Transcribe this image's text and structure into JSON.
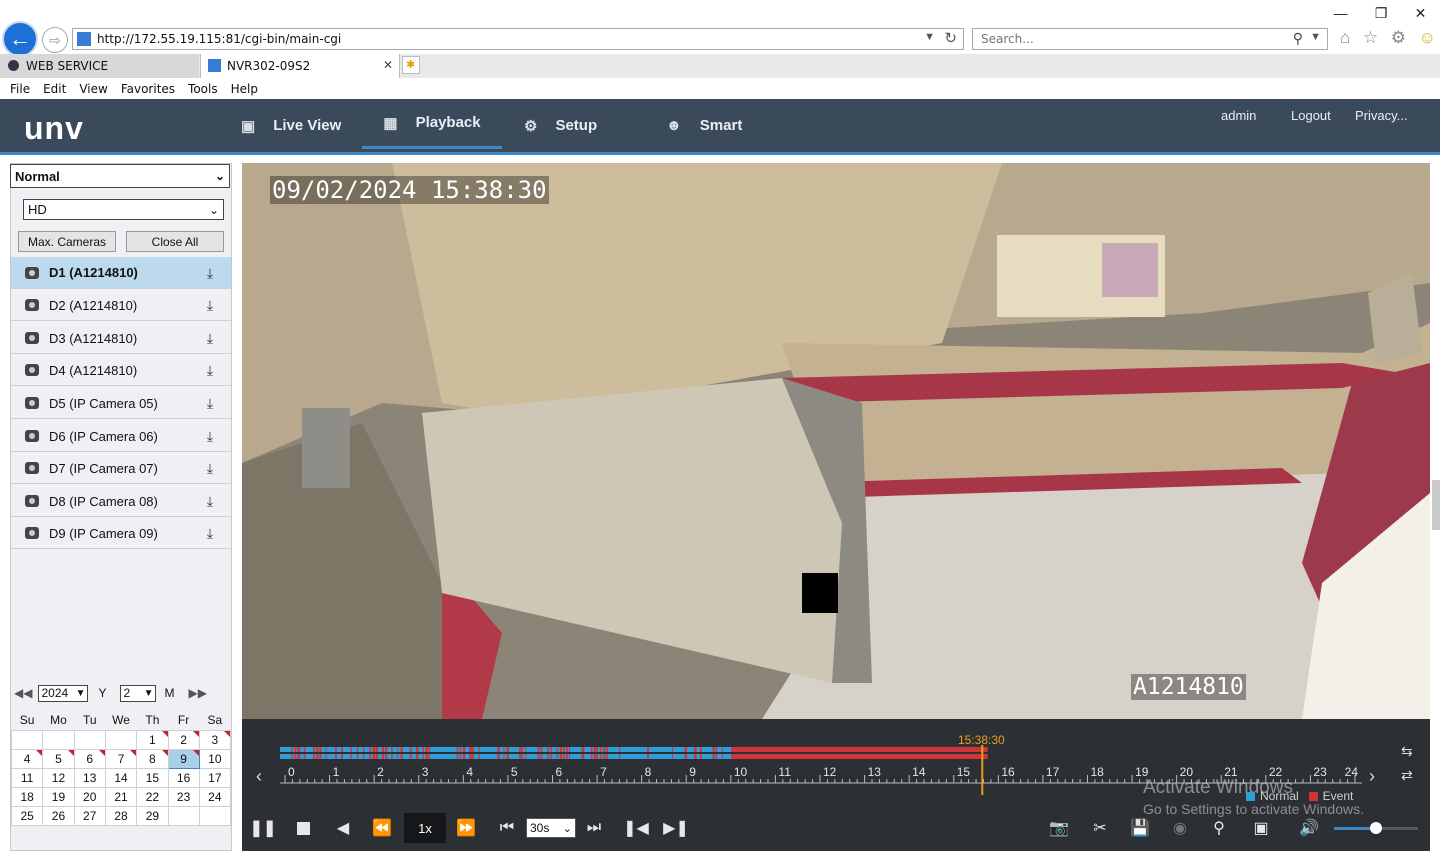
{
  "browser": {
    "url": "http://172.55.19.115:81/cgi-bin/main-cgi",
    "search_placeholder": "Search...",
    "tabs": [
      {
        "label": "WEB SERVICE"
      },
      {
        "label": "NVR302-09S2"
      }
    ],
    "menu": [
      "File",
      "Edit",
      "View",
      "Favorites",
      "Tools",
      "Help"
    ]
  },
  "app": {
    "logo": "unv",
    "nav": [
      {
        "label": "Live View",
        "icon": "monitor-icon"
      },
      {
        "label": "Playback",
        "icon": "film-icon",
        "active": true
      },
      {
        "label": "Setup",
        "icon": "gear-icon"
      },
      {
        "label": "Smart",
        "icon": "smart-user-icon"
      }
    ],
    "user": "admin",
    "logout": "Logout",
    "privacy": "Privacy..."
  },
  "sidebar": {
    "mode_select": "Normal",
    "stream_select": "HD",
    "max_cameras": "Max. Cameras",
    "close_all": "Close All",
    "cameras": [
      {
        "label": "D1 (A1214810)",
        "active": true
      },
      {
        "label": "D2 (A1214810)"
      },
      {
        "label": "D3 (A1214810)"
      },
      {
        "label": "D4 (A1214810)"
      },
      {
        "label": "D5 (IP Camera 05)"
      },
      {
        "label": "D6 (IP Camera 06)"
      },
      {
        "label": "D7 (IP Camera 07)"
      },
      {
        "label": "D8 (IP Camera 08)"
      },
      {
        "label": "D9 (IP Camera 09)"
      }
    ]
  },
  "calendar": {
    "year": "2024",
    "year_label": "Y",
    "month": "2",
    "month_label": "M",
    "weekdays": [
      "Su",
      "Mo",
      "Tu",
      "We",
      "Th",
      "Fr",
      "Sa"
    ],
    "weeks": [
      [
        "",
        "",
        "",
        "",
        "1",
        "2",
        "3"
      ],
      [
        "4",
        "5",
        "6",
        "7",
        "8",
        "9",
        "10"
      ],
      [
        "11",
        "12",
        "13",
        "14",
        "15",
        "16",
        "17"
      ],
      [
        "18",
        "19",
        "20",
        "21",
        "22",
        "23",
        "24"
      ],
      [
        "25",
        "26",
        "27",
        "28",
        "29",
        "",
        ""
      ]
    ],
    "marked_days": [
      "1",
      "2",
      "3",
      "4",
      "5",
      "6",
      "7",
      "8",
      "9"
    ],
    "selected_day": "9"
  },
  "video": {
    "osd_time": "09/02/2024 15:38:30",
    "osd_camera": "A1214810"
  },
  "timeline": {
    "cursor_time": "15:38:30",
    "cursor_hour": 15.64,
    "hour_labels": [
      "0",
      "1",
      "2",
      "3",
      "4",
      "5",
      "6",
      "7",
      "8",
      "9",
      "10",
      "11",
      "12",
      "13",
      "14",
      "15",
      "16",
      "17",
      "18",
      "19",
      "20",
      "21",
      "22",
      "23",
      "24"
    ],
    "normal_color": "#2e9fd8",
    "event_color": "#d0343a",
    "recording_end_hour": 15.75,
    "event_dense_from_hour": 10,
    "legend_normal": "Normal",
    "legend_event": "Event"
  },
  "controls": {
    "speed": "1x",
    "interval": "30s"
  },
  "watermark": {
    "line1": "Activate Windows",
    "line2": "Go to Settings to activate Windows."
  },
  "colors": {
    "header_bg": "#3b4a5b",
    "accent": "#3f86c6",
    "cursor": "#e4a21a"
  }
}
